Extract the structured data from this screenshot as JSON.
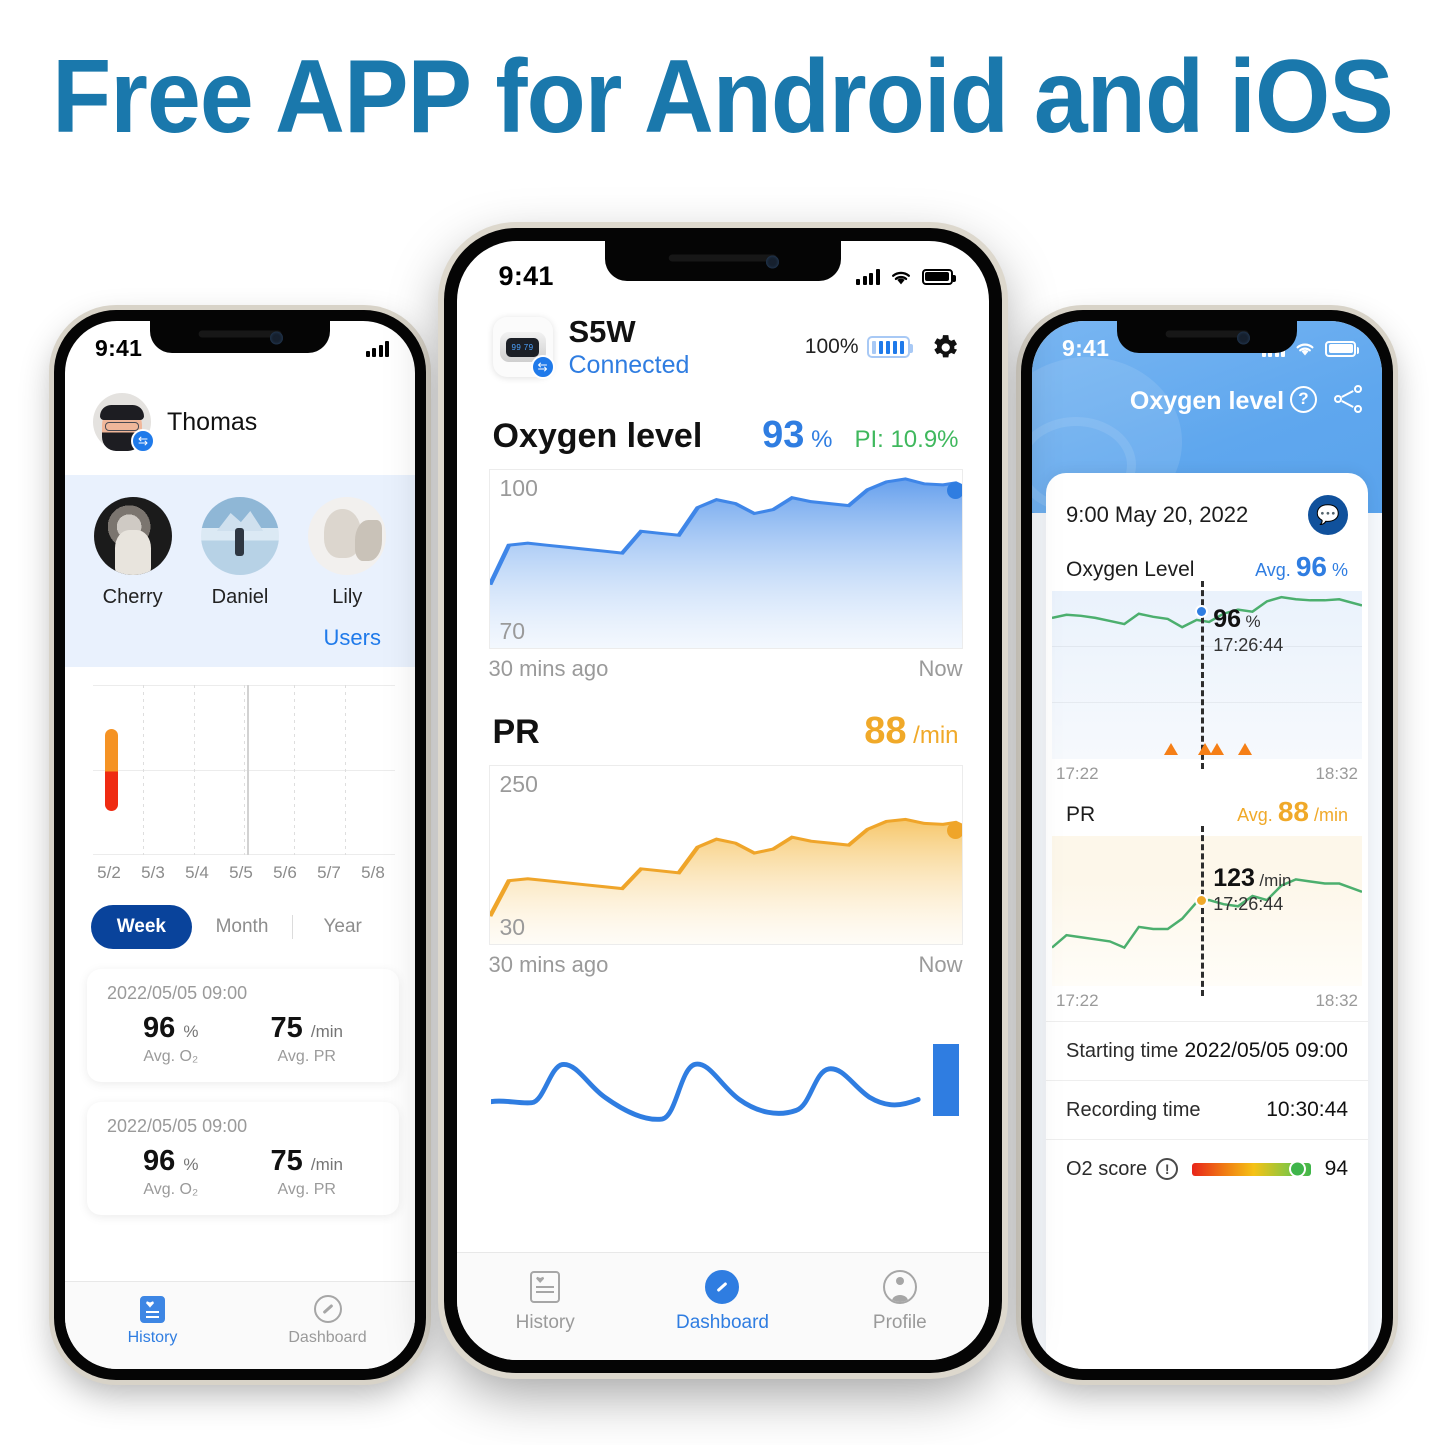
{
  "headline": "Free APP for Android and iOS",
  "headline_color": "#1a78ac",
  "left_phone": {
    "status": {
      "time": "9:41"
    },
    "user": {
      "name": "Thomas",
      "sync_icon": "sync-icon"
    },
    "users": {
      "link_label": "Users",
      "items": [
        {
          "label": "Cherry"
        },
        {
          "label": "Daniel"
        },
        {
          "label": "Lily"
        }
      ]
    },
    "chart": {
      "x_labels": [
        "5/2",
        "5/3",
        "5/4",
        "5/5",
        "5/6",
        "5/7",
        "5/8"
      ]
    },
    "range_tabs": [
      {
        "label": "Week",
        "active": true
      },
      {
        "label": "Month",
        "active": false
      },
      {
        "label": "Year",
        "active": false
      }
    ],
    "records": [
      {
        "timestamp": "2022/05/05 09:00",
        "o2_value": "96",
        "o2_unit": "%",
        "o2_label": "Avg. O₂",
        "pr_value": "75",
        "pr_unit": "/min",
        "pr_label": "Avg. PR"
      },
      {
        "timestamp": "2022/05/05 09:00",
        "o2_value": "96",
        "o2_unit": "%",
        "o2_label": "Avg. O₂",
        "pr_value": "75",
        "pr_unit": "/min",
        "pr_label": "Avg. PR"
      }
    ],
    "tabs": [
      {
        "label": "History",
        "active": true
      },
      {
        "label": "Dashboard",
        "active": false
      }
    ]
  },
  "center_phone": {
    "status": {
      "time": "9:41"
    },
    "device": {
      "name": "S5W",
      "status": "Connected",
      "screen_text": "99 79"
    },
    "battery": {
      "percent": "100%"
    },
    "settings_icon": "gear-icon",
    "oxygen": {
      "title": "Oxygen level",
      "value": "93",
      "unit": "%",
      "pi": "PI: 10.9%",
      "y_max": "100",
      "y_min": "70",
      "x_start": "30 mins ago",
      "x_end": "Now"
    },
    "pr": {
      "title": "PR",
      "value": "88",
      "unit": "/min",
      "y_max": "250",
      "y_min": "30",
      "x_start": "30 mins ago",
      "x_end": "Now"
    },
    "tabs": [
      {
        "label": "History",
        "active": false
      },
      {
        "label": "Dashboard",
        "active": true
      },
      {
        "label": "Profile",
        "active": false
      }
    ]
  },
  "right_phone": {
    "status": {
      "time": "9:41"
    },
    "nav": {
      "title": "Oxygen level",
      "help_icon": "help-icon",
      "share_icon": "share-icon"
    },
    "date": "9:00 May 20, 2022",
    "comment_icon": "comment-icon",
    "oxygen": {
      "section_title": "Oxygen Level",
      "avg_label": "Avg.",
      "avg_value": "96",
      "avg_unit": "%",
      "tip_value": "96",
      "tip_unit": "%",
      "tip_time": "17:26:44",
      "x_start": "17:22",
      "x_end": "18:32"
    },
    "pr": {
      "section_title": "PR",
      "avg_label": "Avg.",
      "avg_value": "88",
      "avg_unit": "/min",
      "tip_value": "123",
      "tip_unit": "/min",
      "tip_time": "17:26:44",
      "x_start": "17:22",
      "x_end": "18:32"
    },
    "rows": [
      {
        "label": "Starting time",
        "value": "2022/05/05 09:00"
      },
      {
        "label": "Recording time",
        "value": "10:30:44"
      },
      {
        "label": "O2 score",
        "value": "94"
      }
    ]
  },
  "chart_data": [
    {
      "type": "area",
      "title": "Oxygen level",
      "ylabel": "%",
      "ylim": [
        70,
        100
      ],
      "xlabel": "",
      "x_ticks": [
        "30 mins ago",
        "Now"
      ],
      "grid": false,
      "color": "#3f86e8",
      "values": [
        80,
        88,
        88,
        87.6,
        87.2,
        86.8,
        86.4,
        86.2,
        89,
        88.6,
        88.4,
        92,
        94,
        93.6,
        92.6,
        93,
        94.4,
        93.8,
        93.6,
        93.4,
        95.4,
        96.4,
        97,
        96.4,
        96.2,
        96.4,
        96.6,
        96
      ],
      "last_value": 93
    },
    {
      "type": "area",
      "title": "PR",
      "ylabel": "/min",
      "ylim": [
        30,
        250
      ],
      "xlabel": "",
      "x_ticks": [
        "30 mins ago",
        "Now"
      ],
      "grid": false,
      "color": "#efa52a",
      "values": [
        52,
        96,
        96,
        95,
        94,
        93,
        92,
        90,
        103,
        101,
        100,
        118,
        126,
        124,
        118,
        120,
        127,
        124,
        123,
        122,
        131,
        136,
        139,
        136,
        135,
        136,
        137,
        134
      ],
      "last_value": 88
    },
    {
      "type": "line",
      "title": "Oxygen Level (detail)",
      "ylabel": "%",
      "avg": 96,
      "x_ticks": [
        "17:22",
        "18:32"
      ],
      "grid": true,
      "color": "#4caf6e",
      "marker": {
        "value": 96,
        "time": "17:26:44"
      },
      "event_markers": [
        3,
        5,
        5.4,
        6.5
      ],
      "values": [
        96,
        96.2,
        96.1,
        96.0,
        95.8,
        95.6,
        96.4,
        96.2,
        96.1,
        95.5,
        96,
        95.9,
        96.3,
        96.5,
        96.4,
        97.2,
        97.6,
        97.4,
        97.3,
        97.3,
        97.4,
        96.8
      ]
    },
    {
      "type": "line",
      "title": "PR (detail)",
      "ylabel": "/min",
      "avg": 88,
      "x_ticks": [
        "17:22",
        "18:32"
      ],
      "grid": true,
      "color": "#4caf6e",
      "marker": {
        "value": 123,
        "time": "17:26:44"
      },
      "values": [
        80,
        88,
        87,
        86,
        85,
        82,
        91,
        90,
        90,
        99,
        123,
        124,
        122,
        121,
        126,
        124,
        130,
        134,
        133,
        132,
        132,
        128
      ]
    }
  ]
}
